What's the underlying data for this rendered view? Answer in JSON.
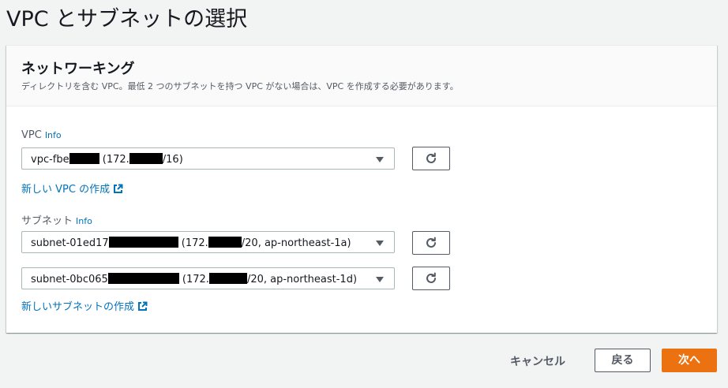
{
  "page": {
    "title": "VPC とサブネットの選択"
  },
  "panel": {
    "title": "ネットワーキング",
    "description": "ディレクトリを含む VPC。最低 2 つのサブネットを持つ VPC がない場合は、VPC を作成する必要があります。"
  },
  "vpc": {
    "label": "VPC",
    "info": "Info",
    "select": {
      "prefix": "vpc-fbe",
      "middle": " (172.",
      "suffix": "/16)"
    },
    "create_link": "新しい VPC の作成"
  },
  "subnet": {
    "label": "サブネット",
    "info": "Info",
    "selects": [
      {
        "prefix": "subnet-01ed17",
        "middle": " (172.",
        "suffix": "/20, ap-northeast-1a)"
      },
      {
        "prefix": "subnet-0bc065",
        "middle": " (172.",
        "suffix": "/20, ap-northeast-1d)"
      }
    ],
    "create_link": "新しいサブネットの作成"
  },
  "footer": {
    "cancel": "キャンセル",
    "back": "戻る",
    "next": "次へ"
  },
  "colors": {
    "accent": "#ec7211",
    "link": "#0073bb",
    "background": "#f2f3f3"
  },
  "icons": {
    "refresh": "refresh-icon",
    "external_link": "external-link-icon",
    "dropdown": "caret-down-icon"
  }
}
